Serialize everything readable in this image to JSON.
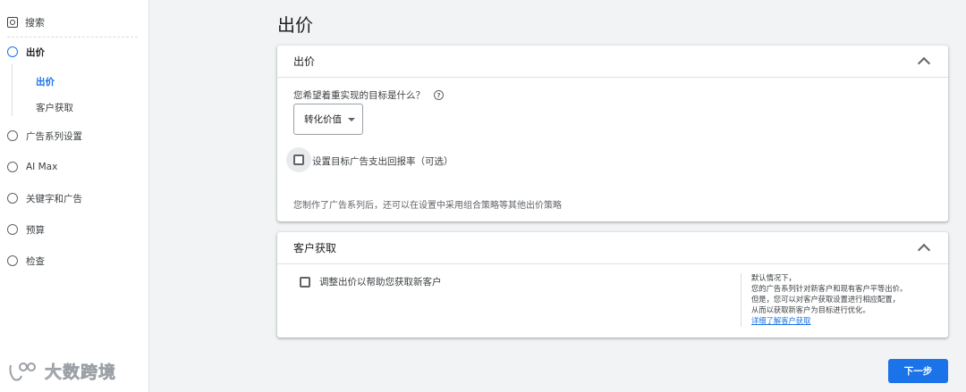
{
  "sidebar": {
    "search_label": "搜索",
    "items": [
      {
        "label": "出价",
        "active": true
      },
      {
        "label": "广告系列设置"
      },
      {
        "label": "AI Max"
      },
      {
        "label": "关键字和广告"
      },
      {
        "label": "预算"
      },
      {
        "label": "检查"
      }
    ],
    "subitems": [
      {
        "label": "出价",
        "active": true
      },
      {
        "label": "客户获取"
      }
    ],
    "watermark": "大数跨境"
  },
  "page": {
    "title": "出价"
  },
  "bidding_card": {
    "title": "出价",
    "question": "您希望着重实现的目标是什么？",
    "help_icon": "?",
    "select_value": "转化价值",
    "checkbox_label": "设置目标广告支出回报率（可选）",
    "note": "您制作了广告系列后，还可以在设置中采用组合策略等其他出价策略"
  },
  "acquisition_card": {
    "title": "客户获取",
    "checkbox_label": "调整出价以帮助您获取新客户",
    "info_lines": [
      "默认情况下，",
      "您的广告系列针对新客户和现有客户平等出价。",
      "但是，您可以对客户获取设置进行相应配置，",
      "从而以获取新客户为目标进行优化。"
    ],
    "link": "详细了解客户获取"
  },
  "footer": {
    "next_label": "下一步"
  },
  "colors": {
    "accent": "#1a73e8",
    "background": "#f1f3f4"
  }
}
